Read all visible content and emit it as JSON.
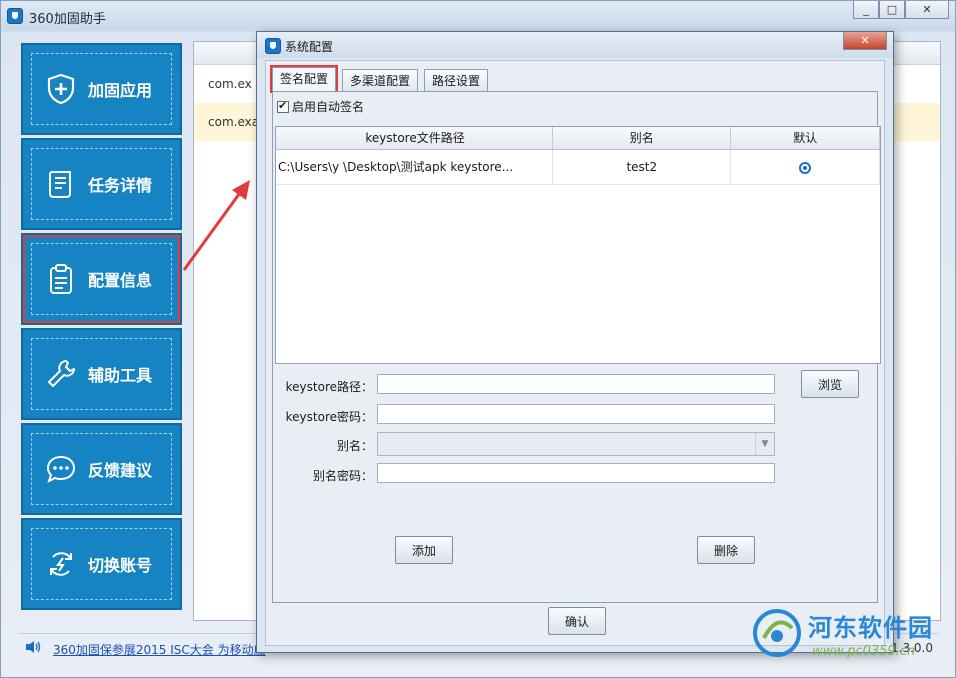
{
  "main_window": {
    "title": "360加固助手",
    "controls": {
      "minimize": "_",
      "maximize": "□",
      "close": "✕"
    }
  },
  "sidebar": {
    "items": [
      {
        "label": "加固应用",
        "icon": "shield-plus-icon"
      },
      {
        "label": "任务详情",
        "icon": "document-list-icon"
      },
      {
        "label": "配置信息",
        "icon": "clipboard-icon"
      },
      {
        "label": "辅助工具",
        "icon": "wrench-icon"
      },
      {
        "label": "反馈建议",
        "icon": "chat-bubble-icon"
      },
      {
        "label": "切换账号",
        "icon": "switch-account-icon"
      }
    ],
    "active_index": 2
  },
  "task_list": {
    "rows": [
      "com.ex",
      "com.exan"
    ]
  },
  "news": {
    "link_text": "360加固保参展2015 ISC大会 为移动应",
    "version": "1.3.0.0"
  },
  "dialog": {
    "title": "系统配置",
    "close": "✕",
    "tabs": [
      "签名配置",
      "多渠道配置",
      "路径设置"
    ],
    "active_tab": 0,
    "auto_sign_label": "启用自动签名",
    "auto_sign_checked": true,
    "table": {
      "headers": [
        "keystore文件路径",
        "别名",
        "默认"
      ],
      "rows": [
        {
          "path": "C:\\Users\\y          \\Desktop\\测试apk keystore...",
          "alias": "test2",
          "default": true
        }
      ]
    },
    "form": {
      "keystore_path_label": "keystore路径：",
      "keystore_password_label": "keystore密码：",
      "alias_label": "别名：",
      "alias_password_label": "别名密码：",
      "keystore_path_value": "",
      "keystore_password_value": "",
      "alias_password_value": ""
    },
    "buttons": {
      "browse": "浏览",
      "add": "添加",
      "delete": "删除",
      "confirm": "确认"
    }
  },
  "watermark": {
    "name": "河东软件园",
    "url": "www.pc0359.cn"
  },
  "colors": {
    "sidebar_bg": "#1683c2",
    "highlight_red": "#e33b3b",
    "link_blue": "#1a4fb3"
  }
}
